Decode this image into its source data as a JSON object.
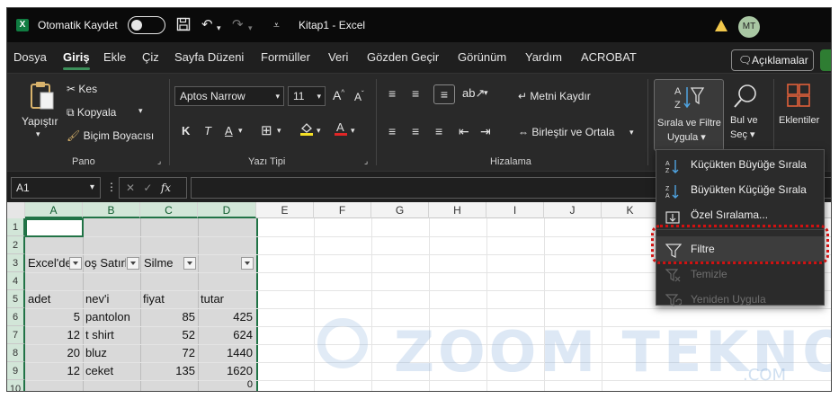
{
  "titlebar": {
    "autosave_label": "Otomatik Kaydet",
    "doc_title": "Kitap1  -  Excel",
    "avatar_initials": "MT",
    "logo_letter": "X"
  },
  "menubar": {
    "tabs": [
      "Dosya",
      "Giriş",
      "Ekle",
      "Çiz",
      "Sayfa Düzeni",
      "Formüller",
      "Veri",
      "Gözden Geçir",
      "Görünüm",
      "Yardım",
      "ACROBAT"
    ],
    "active_tab": "Giriş",
    "comments_label": "Açıklamalar"
  },
  "ribbon": {
    "pano": {
      "paste": "Yapıştır",
      "cut": "Kes",
      "copy": "Kopyala",
      "format_painter": "Biçim Boyacısı",
      "label": "Pano"
    },
    "font": {
      "family": "Aptos Narrow",
      "size": "11",
      "bold": "K",
      "italic": "T",
      "underline": "A",
      "label": "Yazı Tipi"
    },
    "alignment": {
      "wrap_text": "Metni Kaydır",
      "merge_center": "Birleştir ve Ortala",
      "label": "Hizalama"
    },
    "sort_filter": {
      "line1": "Sırala ve Filtre",
      "line2": "Uygula"
    },
    "find_select": {
      "line1": "Bul ve",
      "line2": "Seç"
    },
    "addins": {
      "label": "Eklentiler"
    }
  },
  "formula_bar": {
    "name_box": "A1",
    "fx": "fx",
    "value": ""
  },
  "grid": {
    "columns": [
      "A",
      "B",
      "C",
      "D",
      "E",
      "F",
      "G",
      "H",
      "I",
      "J",
      "K"
    ],
    "rows": [
      "1",
      "2",
      "3",
      "4",
      "5",
      "6",
      "7",
      "8",
      "9",
      "10"
    ],
    "header_row": [
      "Excel'de",
      "oş Satırl",
      "Silme",
      ""
    ],
    "labels_row": [
      "adet",
      "nev'i",
      "fiyat",
      "tutar"
    ],
    "data": [
      [
        "5",
        "pantolon",
        "85",
        "425"
      ],
      [
        "12",
        "t shirt",
        "52",
        "624"
      ],
      [
        "20",
        "bluz",
        "72",
        "1440"
      ],
      [
        "12",
        "ceket",
        "135",
        "1620"
      ]
    ],
    "row10_value": "0"
  },
  "sort_menu": {
    "items": [
      {
        "label": "Küçükten Büyüğe Sırala",
        "enabled": true
      },
      {
        "label": "Büyükten Küçüğe Sırala",
        "enabled": true
      },
      {
        "label": "Özel Sıralama...",
        "enabled": true
      },
      {
        "label": "Filtre",
        "enabled": true
      },
      {
        "label": "Temizle",
        "enabled": false
      },
      {
        "label": "Yeniden Uygula",
        "enabled": false
      }
    ]
  },
  "watermark": {
    "text": "ZOOM TEKNO",
    "suffix": ".COM"
  },
  "colors": {
    "accent": "#217346",
    "highlight": "#d31111"
  }
}
